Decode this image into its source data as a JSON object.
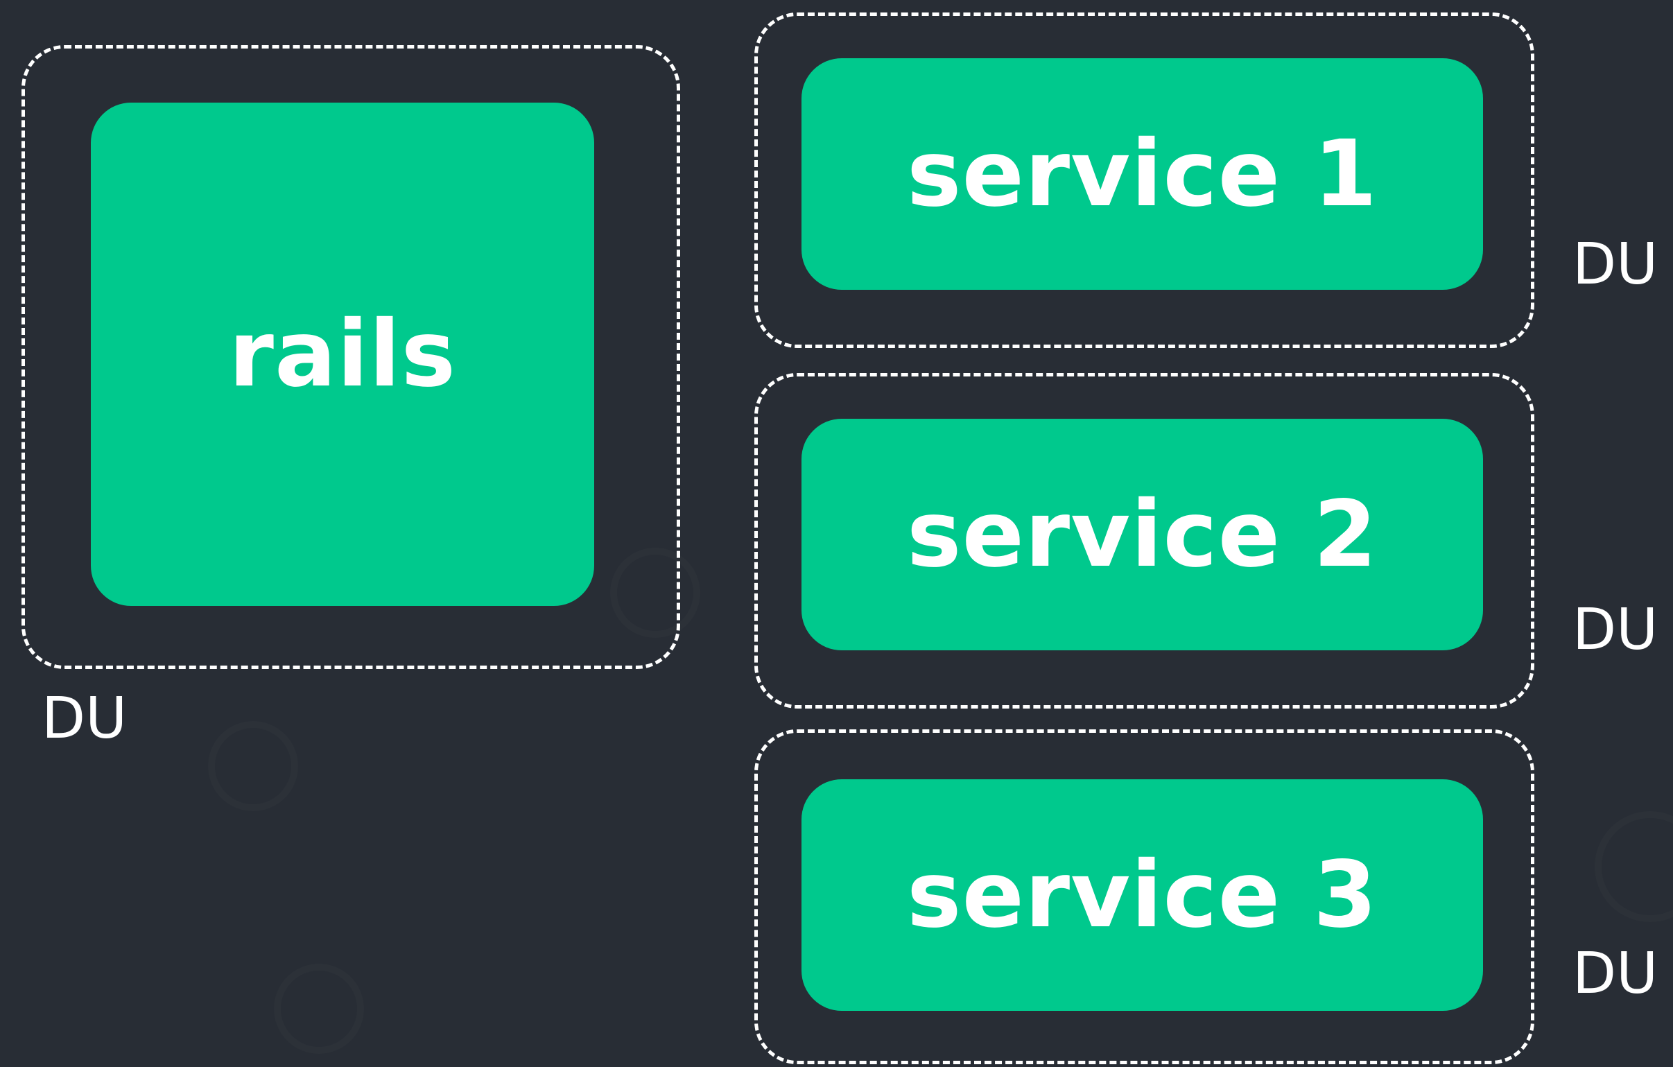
{
  "colors": {
    "background": "#282d35",
    "unit_fill": "#00c98d",
    "unit_text": "#ffffff",
    "group_border": "#ffffff",
    "du_text": "#ffffff"
  },
  "units": [
    {
      "label": "rails",
      "du_label": "DU"
    },
    {
      "label": "service 1",
      "du_label": "DU"
    },
    {
      "label": "service 2",
      "du_label": "DU"
    },
    {
      "label": "service 3",
      "du_label": "DU"
    }
  ]
}
